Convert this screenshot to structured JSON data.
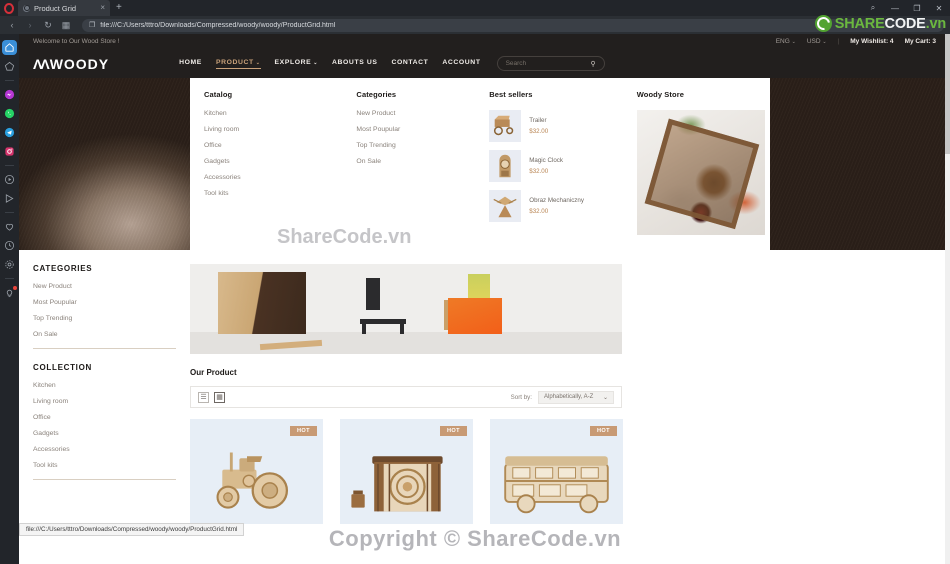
{
  "browser": {
    "app": "opera",
    "tab": {
      "title": "Product Grid",
      "close": "×"
    },
    "newtab": "+",
    "nav": {
      "back": "‹",
      "forward": "›",
      "reload": "↻",
      "tabsmenu": "▦"
    },
    "url": "file:///C:/Users/tttro/Downloads/Compressed/woody/woody/ProductGrid.html",
    "page_icon": "❐",
    "window_controls": {
      "search": "⌕",
      "minimize": "—",
      "maximize": "❐",
      "close": "✕"
    },
    "status_bar_url": "file:///C:/Users/tttro/Downloads/Compressed/woody/woody/ProductGrid.html",
    "sidebar": [
      {
        "name": "sidebar-item-home",
        "icon": "home-icon",
        "active": true
      },
      {
        "name": "sidebar-item-workspace",
        "icon": "pentagon-icon",
        "active": false
      },
      {
        "name": "sidebar-item-messenger",
        "icon": "messenger-icon",
        "active": false
      },
      {
        "name": "sidebar-item-whatsapp",
        "icon": "whatsapp-icon",
        "active": false
      },
      {
        "name": "sidebar-item-telegram",
        "icon": "telegram-icon",
        "active": false
      },
      {
        "name": "sidebar-item-instagram",
        "icon": "instagram-icon",
        "active": false
      },
      {
        "name": "sidebar-item-player",
        "icon": "play-circle-icon",
        "active": false
      },
      {
        "name": "sidebar-item-send",
        "icon": "paper-plane-icon",
        "active": false
      },
      {
        "name": "sidebar-item-favorites",
        "icon": "heart-icon",
        "active": false
      },
      {
        "name": "sidebar-item-history",
        "icon": "clock-icon",
        "active": false
      },
      {
        "name": "sidebar-item-settings",
        "icon": "gear-icon",
        "active": false
      },
      {
        "name": "sidebar-item-tips",
        "icon": "bulb-icon",
        "active": false,
        "badge": true
      }
    ]
  },
  "watermark": {
    "brand_share": "SHARE",
    "brand_code": "CODE",
    "brand_tld": ".vn",
    "center": "ShareCode.vn",
    "bottom": "Copyright © ShareCode.vn"
  },
  "site": {
    "topbar": {
      "welcome": "Welcome to Our Wood Store !",
      "language": "ENG",
      "currency": "USD",
      "caret": "⌄",
      "divider": "|",
      "wishlist": "My Wishlist: 4",
      "cart": "My Cart: 3"
    },
    "header": {
      "logo_mark": "ΛΛ",
      "logo_word": "WOODY",
      "nav": [
        {
          "label": "HOME",
          "active": false,
          "caret": ""
        },
        {
          "label": "PRODUCT",
          "active": true,
          "caret": "⌄"
        },
        {
          "label": "EXPLORE",
          "active": false,
          "caret": "⌄"
        },
        {
          "label": "ABOUTS US",
          "active": false,
          "caret": ""
        },
        {
          "label": "CONTACT",
          "active": false,
          "caret": ""
        },
        {
          "label": "ACCOUNT",
          "active": false,
          "caret": ""
        }
      ],
      "search": {
        "placeholder": "Search",
        "value": "",
        "icon": "search-icon"
      }
    },
    "megamenu": {
      "catalog": {
        "title": "Catalog",
        "items": [
          "Kitchen",
          "Living room",
          "Office",
          "Gadgets",
          "Accessories",
          "Tool kits"
        ]
      },
      "categories": {
        "title": "Categories",
        "items": [
          "New Product",
          "Most Poupular",
          "Top Trending",
          "On Sale"
        ]
      },
      "best_sellers": {
        "title": "Best sellers",
        "items": [
          {
            "name": "Trailer",
            "price": "$32.00"
          },
          {
            "name": "Magic Clock",
            "price": "$32.00"
          },
          {
            "name": "Obraz Mechaniczny",
            "price": "$32.00"
          }
        ]
      },
      "store": {
        "title": "Woody Store"
      }
    },
    "sidebar": {
      "categories": {
        "title": "CATEGORIES",
        "items": [
          "New Product",
          "Most Poupular",
          "Top Trending",
          "On Sale"
        ]
      },
      "collection": {
        "title": "COLLECTION",
        "items": [
          "Kitchen",
          "Living room",
          "Office",
          "Gadgets",
          "Accessories",
          "Tool kits"
        ]
      }
    },
    "main": {
      "section_title": "Our Product",
      "toolbar": {
        "grid_view_icon": "grid-view-icon",
        "list_view_icon": "list-view-icon",
        "sort_label": "Sort by:",
        "sort_value": "Alphabetically, A-Z",
        "sort_caret": "⌄"
      },
      "products": [
        {
          "badge": "HOT",
          "alt": "wooden tractor model kit"
        },
        {
          "badge": "HOT",
          "alt": "wooden music box model kit"
        },
        {
          "badge": "HOT",
          "alt": "wooden double decker bus model kit"
        }
      ]
    },
    "colors": {
      "header_bg": "#221f1e",
      "accent": "#c9a27a",
      "price": "#b98553",
      "badge": "#c89a74",
      "card_bg": "#e7eef6"
    }
  }
}
